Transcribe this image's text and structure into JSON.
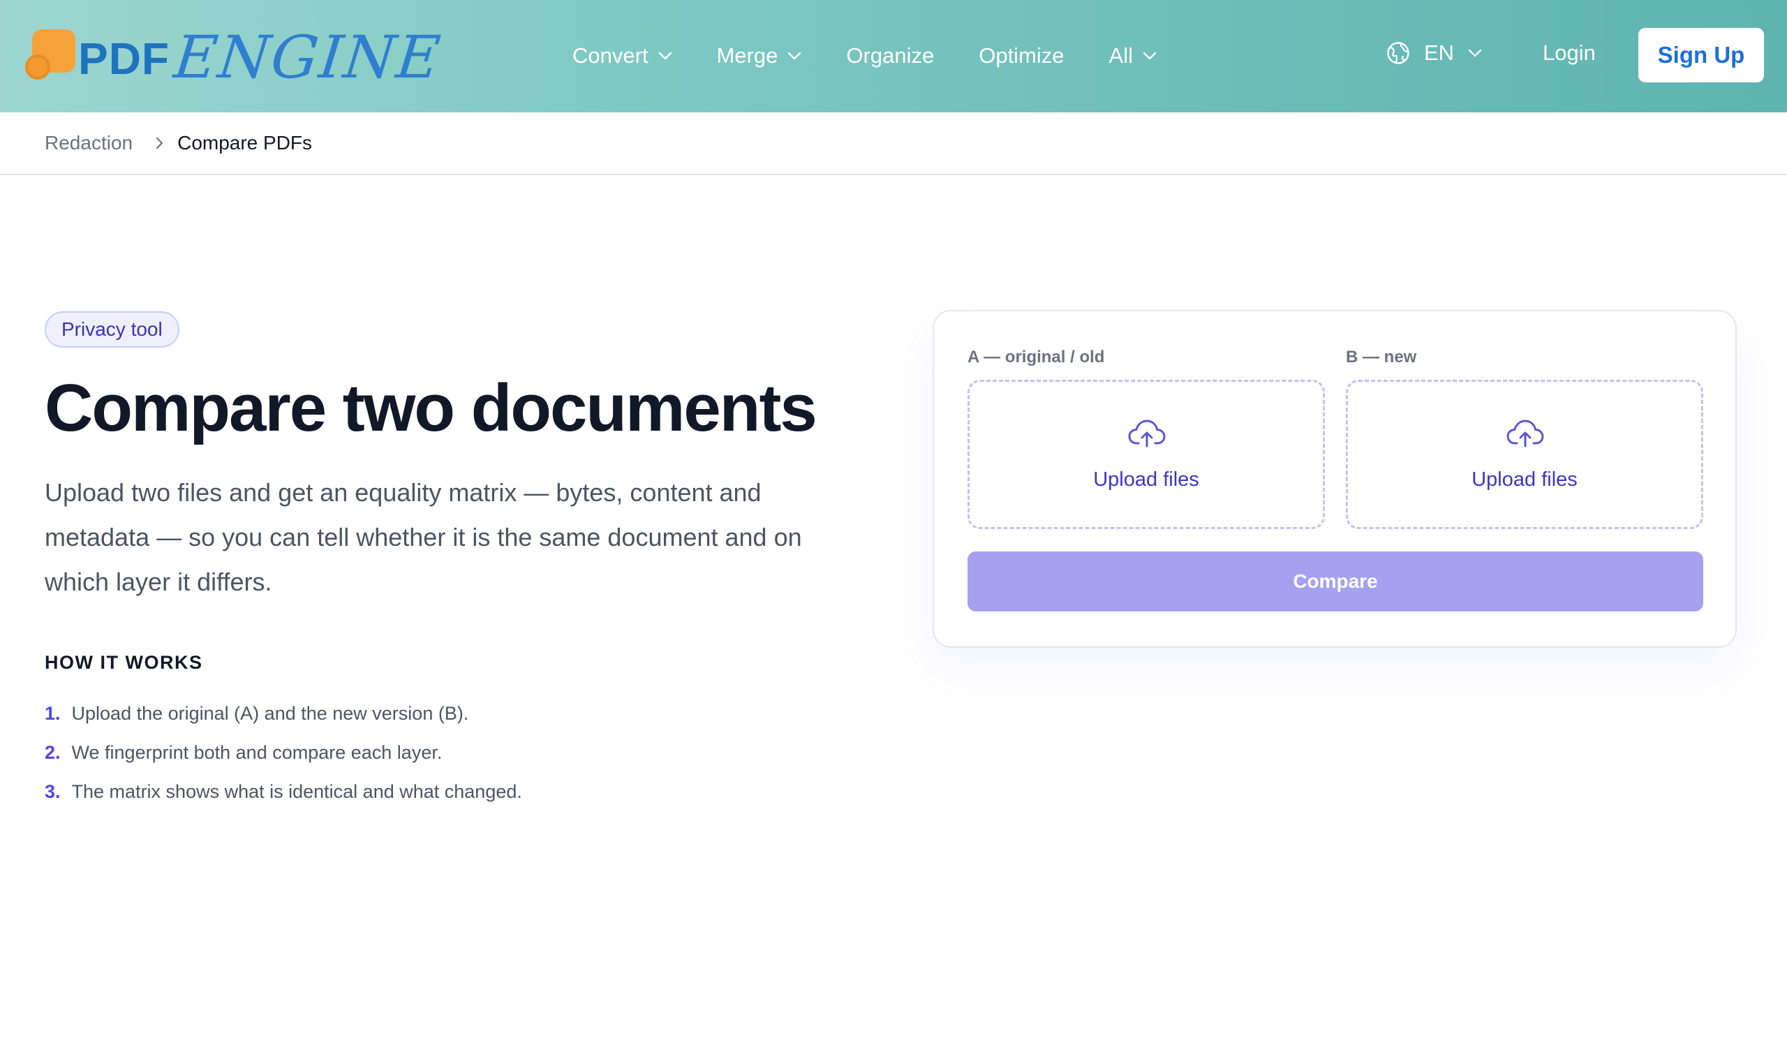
{
  "brand": {
    "logo_text_pdf": "PDF",
    "logo_text_engine": "ENGINE"
  },
  "nav": {
    "items": [
      {
        "label": "Convert",
        "has_dropdown": true
      },
      {
        "label": "Merge",
        "has_dropdown": true
      },
      {
        "label": "Organize",
        "has_dropdown": false
      },
      {
        "label": "Optimize",
        "has_dropdown": false
      },
      {
        "label": "All",
        "has_dropdown": true
      }
    ],
    "language": "EN",
    "login_label": "Login",
    "signup_label": "Sign Up"
  },
  "breadcrumb": {
    "parent": "Redaction",
    "current": "Compare PDFs"
  },
  "hero": {
    "badge": "Privacy tool",
    "title": "Compare two documents",
    "lead": "Upload two files and get an equality matrix — bytes, content and metadata — so you can tell whether it is the same document and on which layer it differs."
  },
  "how_it_works": {
    "title": "HOW IT WORKS",
    "steps": [
      {
        "num": "1.",
        "text": "Upload the original (A) and the new version (B)."
      },
      {
        "num": "2.",
        "text": "We fingerprint both and compare each layer."
      },
      {
        "num": "3.",
        "text": "The matrix shows what is identical and what changed."
      }
    ]
  },
  "compare_card": {
    "slot_a_label": "A — original / old",
    "slot_b_label": "B — new",
    "slot_a_upload": "Upload files",
    "slot_b_upload": "Upload files",
    "compare_label": "Compare"
  },
  "colors": {
    "header_gradient_start": "#9dd6d0",
    "header_gradient_end": "#5fb4b0",
    "accent": "#4f46e5",
    "compare_button": "#a5a1f0",
    "signup_text": "#1e6fd9",
    "logo_orange": "#f5a23a",
    "logo_blue": "#1e73be"
  },
  "icons": {
    "nav_dropdown": "chevron-down-icon",
    "language": "globe-icon",
    "breadcrumb_separator": "chevron-right-icon",
    "upload": "cloud-upload-icon"
  }
}
